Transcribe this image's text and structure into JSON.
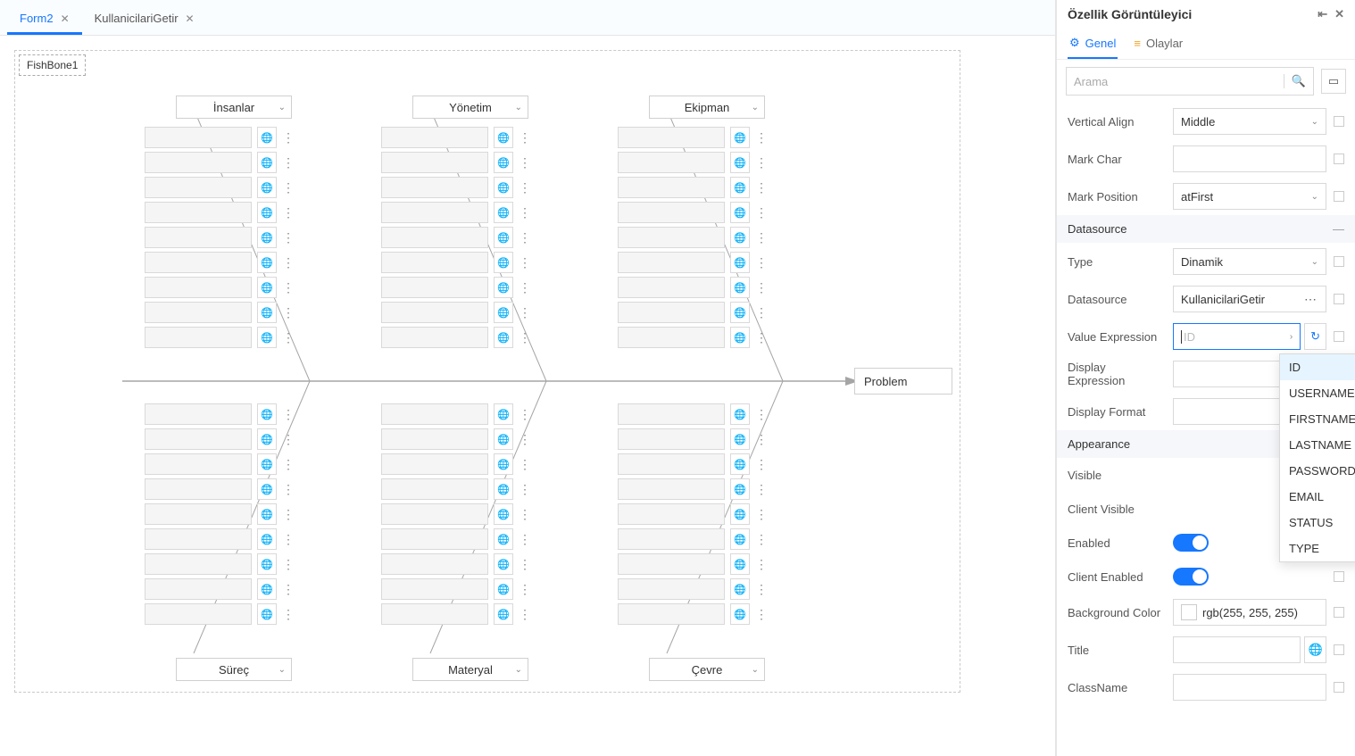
{
  "tabs": [
    {
      "label": "Form2",
      "active": true
    },
    {
      "label": "KullanicilariGetir",
      "active": false
    }
  ],
  "fishbone": {
    "component_label": "FishBone1",
    "top_categories": [
      "İnsanlar",
      "Yönetim",
      "Ekipman"
    ],
    "bottom_categories": [
      "Süreç",
      "Materyal",
      "Çevre"
    ],
    "problem_label": "Problem"
  },
  "panel": {
    "title": "Özellik Görüntüleyici",
    "tab_general": "Genel",
    "tab_events": "Olaylar",
    "search_placeholder": "Arama",
    "groups": {
      "datasource": "Datasource",
      "appearance": "Appearance"
    },
    "props": {
      "vertical_align_label": "Vertical Align",
      "vertical_align_value": "Middle",
      "mark_char_label": "Mark Char",
      "mark_char_value": "",
      "mark_position_label": "Mark Position",
      "mark_position_value": "atFirst",
      "type_label": "Type",
      "type_value": "Dinamik",
      "datasource_label": "Datasource",
      "datasource_value": "KullanicilariGetir",
      "value_expr_label": "Value Expression",
      "value_expr_placeholder": "ID",
      "display_expr_label": "Display Expression",
      "display_expr_value": "",
      "display_format_label": "Display Format",
      "display_format_value": "",
      "visible_label": "Visible",
      "client_visible_label": "Client Visible",
      "enabled_label": "Enabled",
      "client_enabled_label": "Client Enabled",
      "bg_color_label": "Background Color",
      "bg_color_value": "rgb(255, 255, 255)",
      "title_label": "Title",
      "title_value": "",
      "classname_label": "ClassName"
    },
    "dropdown_options": [
      "ID",
      "USERNAME",
      "FIRSTNAME",
      "LASTNAME",
      "PASSWORD",
      "EMAIL",
      "STATUS",
      "TYPE"
    ]
  }
}
